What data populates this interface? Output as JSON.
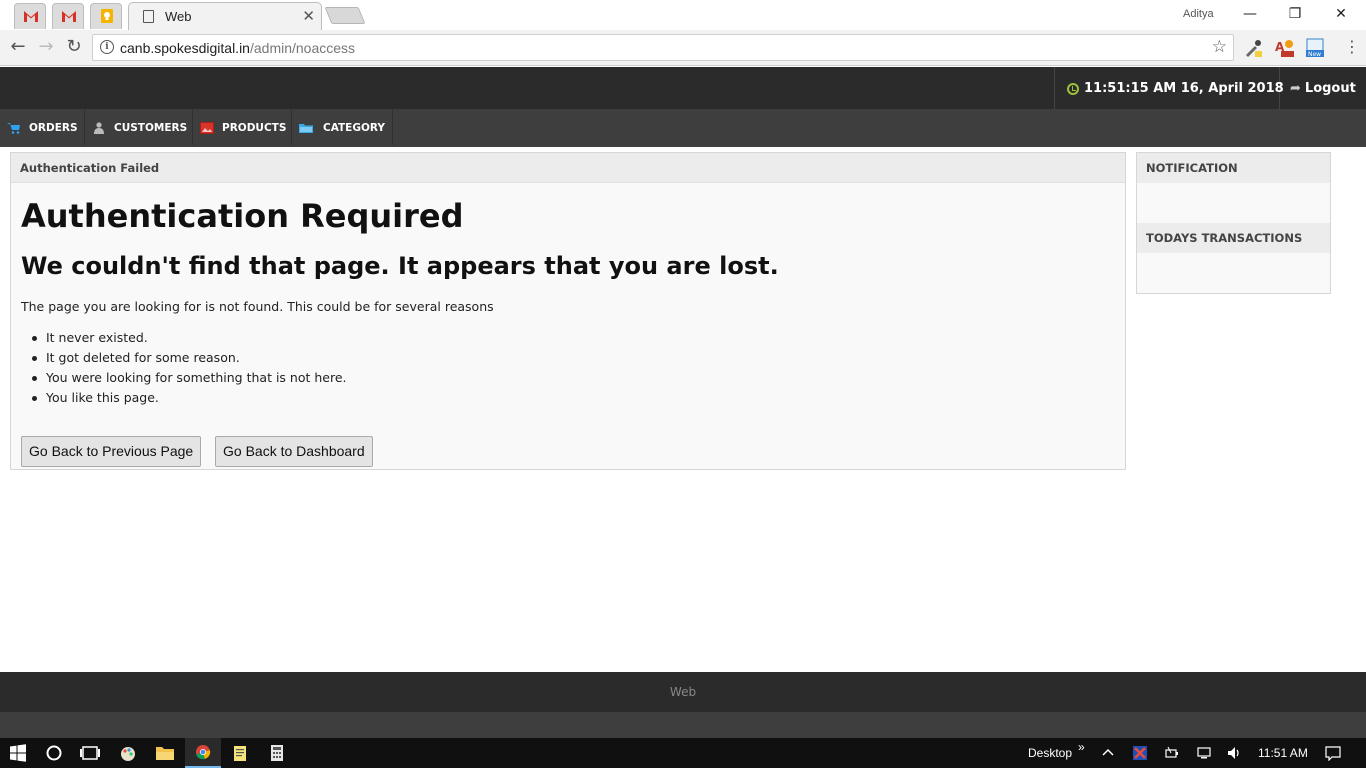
{
  "browser": {
    "tab_title": "Web",
    "tab_close": "✕",
    "user_name": "Aditya",
    "url_host": "canb.spokesdigital.in",
    "url_path": "/admin/noaccess",
    "window_controls": {
      "minimize": "—",
      "restore": "❐",
      "close": "✕"
    },
    "nav": {
      "back": "←",
      "forward": "→",
      "reload": "↻",
      "star": "☆"
    }
  },
  "header": {
    "datetime": "11:51:15 AM 16, April 2018",
    "logout_label": "Logout"
  },
  "menu": {
    "items": [
      {
        "label": "ORDERS",
        "icon": "cart-icon",
        "color": "#2ea3f2"
      },
      {
        "label": "CUSTOMERS",
        "icon": "user-icon",
        "color": "#bbbbbb"
      },
      {
        "label": "PRODUCTS",
        "icon": "image-icon",
        "color": "#d9342b"
      },
      {
        "label": "CATEGORY",
        "icon": "folder-icon",
        "color": "#3aa9e8"
      }
    ]
  },
  "main": {
    "panel_title": "Authentication Failed",
    "heading": "Authentication Required",
    "subheading": "We couldn't find that page. It appears that you are lost.",
    "intro": "The page you are looking for is not found. This could be for several reasons",
    "reasons": [
      "It never existed.",
      "It got deleted for some reason.",
      "You were looking for something that is not here.",
      "You like this page."
    ],
    "buttons": {
      "back_previous": "Go Back to Previous Page",
      "back_dashboard": "Go Back to Dashboard"
    }
  },
  "sidebar": {
    "notification_title": "NOTIFICATION",
    "transactions_title": "TODAYS TRANSACTIONS"
  },
  "footer": {
    "text": "Web"
  },
  "taskbar": {
    "desktop_label": "Desktop",
    "chevron": "»",
    "time": "11:51 AM"
  },
  "colors": {
    "header_bg": "#2b2b2b",
    "menu_bg": "#3e3e3e",
    "clock_accent": "#9bc13c"
  }
}
